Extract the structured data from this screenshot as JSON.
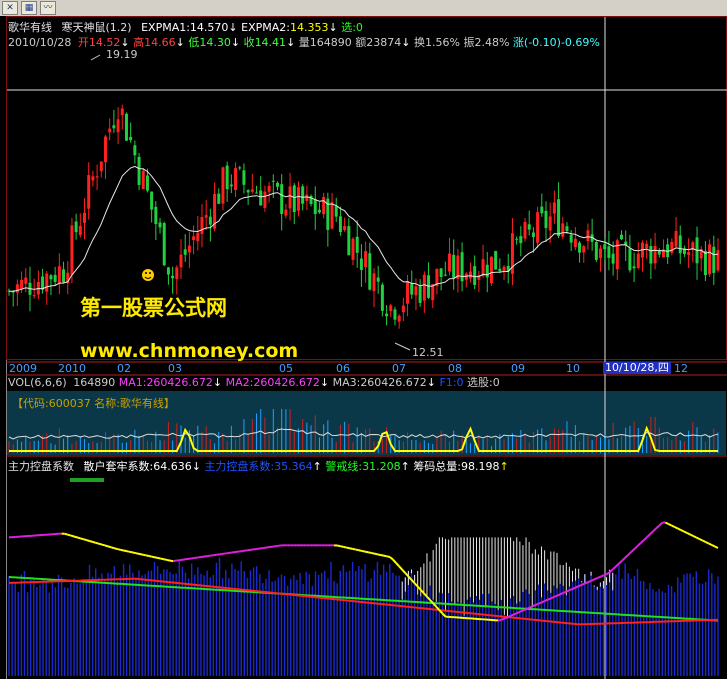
{
  "toolbar": {
    "icons": [
      "close-icon",
      "table-icon",
      "chart-icon"
    ]
  },
  "header": {
    "name": "歌华有线",
    "indicator": "寒天神鼠(1.2)",
    "expma1_label": "EXPMA1:",
    "expma1": "14.570",
    "expma2_label": "EXPMA2:",
    "expma2": "14.353",
    "xuan_label": "选:",
    "xuan": "0"
  },
  "ohlc": {
    "date": "2010/10/28",
    "open_label": "开",
    "open": "14.52",
    "high_label": "高",
    "high": "14.66",
    "low_label": "低",
    "low": "14.30",
    "close_label": "收",
    "close": "14.41",
    "vol_label": "量",
    "vol": "164890",
    "amount_label": "额",
    "amount": "23874",
    "turnover_label": "换",
    "turnover": "1.56%",
    "amplitude_label": "振",
    "amplitude": "2.48%",
    "change_label": "涨",
    "change": "(-0.10)-0.69%"
  },
  "watermark": {
    "line1": "第一股票公式网",
    "line2": "www.chnmoney.com"
  },
  "annotations": {
    "high_mark": "19.19",
    "low_mark": "12.51",
    "cursor_date": "10/10/28,四"
  },
  "time_axis": {
    "labels": [
      "2009",
      "2010",
      "02",
      "03",
      "05",
      "06",
      "07",
      "08",
      "09",
      "10",
      "12"
    ]
  },
  "volume_header": {
    "title": "VOL(6,6,6)",
    "vol": "164890",
    "ma1_label": "MA1:",
    "ma1": "260426.672",
    "ma2_label": "MA2:",
    "ma2": "260426.672",
    "ma3_label": "MA3:",
    "ma3": "260426.672",
    "f1_label": "F1:0",
    "xuangu_label": "选股:",
    "xuangu": "0"
  },
  "volume_inner": {
    "code_label": "【代码:600037  名称:歌华有线】"
  },
  "bottom_header": {
    "title": "主力控盘系数",
    "sanhu_label": "散户套牢系数:",
    "sanhu": "64.636",
    "zhuli_label": "主力控盘系数:",
    "zhuli": "35.364",
    "jingjie_label": "警戒线:",
    "jingjie": "31.208",
    "chouma_label": "筹码总量:",
    "chouma": "98.198"
  },
  "colors": {
    "up": "#ff2020",
    "down": "#20d040",
    "ma": "#e8e8e8",
    "yellow": "#ffff00",
    "magenta": "#e020e0",
    "green_line": "#20e020",
    "red_line": "#ff2020",
    "blue_bar": "#1a2ad0",
    "white_bar": "#e8e8e8",
    "teal_bg": "#0a3848",
    "watermark": "#ffea00"
  },
  "chart_data": [
    {
      "type": "candlestick",
      "name": "歌华有线",
      "x": [
        "2009",
        "2010",
        "02",
        "03",
        "05",
        "06",
        "07",
        "08",
        "09",
        "10",
        "12"
      ],
      "y_close": [
        13.6,
        14.2,
        18.6,
        14.0,
        16.6,
        16.0,
        15.6,
        13.2,
        14.1,
        14.4,
        15.6,
        14.4,
        14.8,
        14.41
      ],
      "high": 19.19,
      "low": 12.51,
      "ylim": [
        12.0,
        20.0
      ]
    },
    {
      "type": "bar",
      "name": "VOL(6,6,6)",
      "values_relative": [
        0.2,
        0.4,
        0.3,
        0.5,
        0.4,
        0.9,
        0.5,
        0.4,
        0.35,
        0.3,
        0.5,
        0.45,
        0.6,
        0.4
      ]
    },
    {
      "type": "area",
      "name": "主力控盘系数",
      "series": [
        {
          "name": "散户套牢系数",
          "values": [
            70,
            72,
            64,
            58,
            62,
            66,
            66,
            60,
            30,
            28,
            40,
            52,
            78,
            64.636
          ]
        },
        {
          "name": "主力控盘系数",
          "values": [
            30,
            28,
            36,
            42,
            38,
            34,
            34,
            40,
            70,
            72,
            60,
            48,
            22,
            35.364
          ]
        },
        {
          "name": "警戒线",
          "values": [
            30,
            30,
            31,
            31,
            31,
            31,
            31,
            31,
            31,
            31,
            31,
            31,
            31,
            31.208
          ]
        }
      ],
      "ylim": [
        0,
        100
      ]
    }
  ]
}
